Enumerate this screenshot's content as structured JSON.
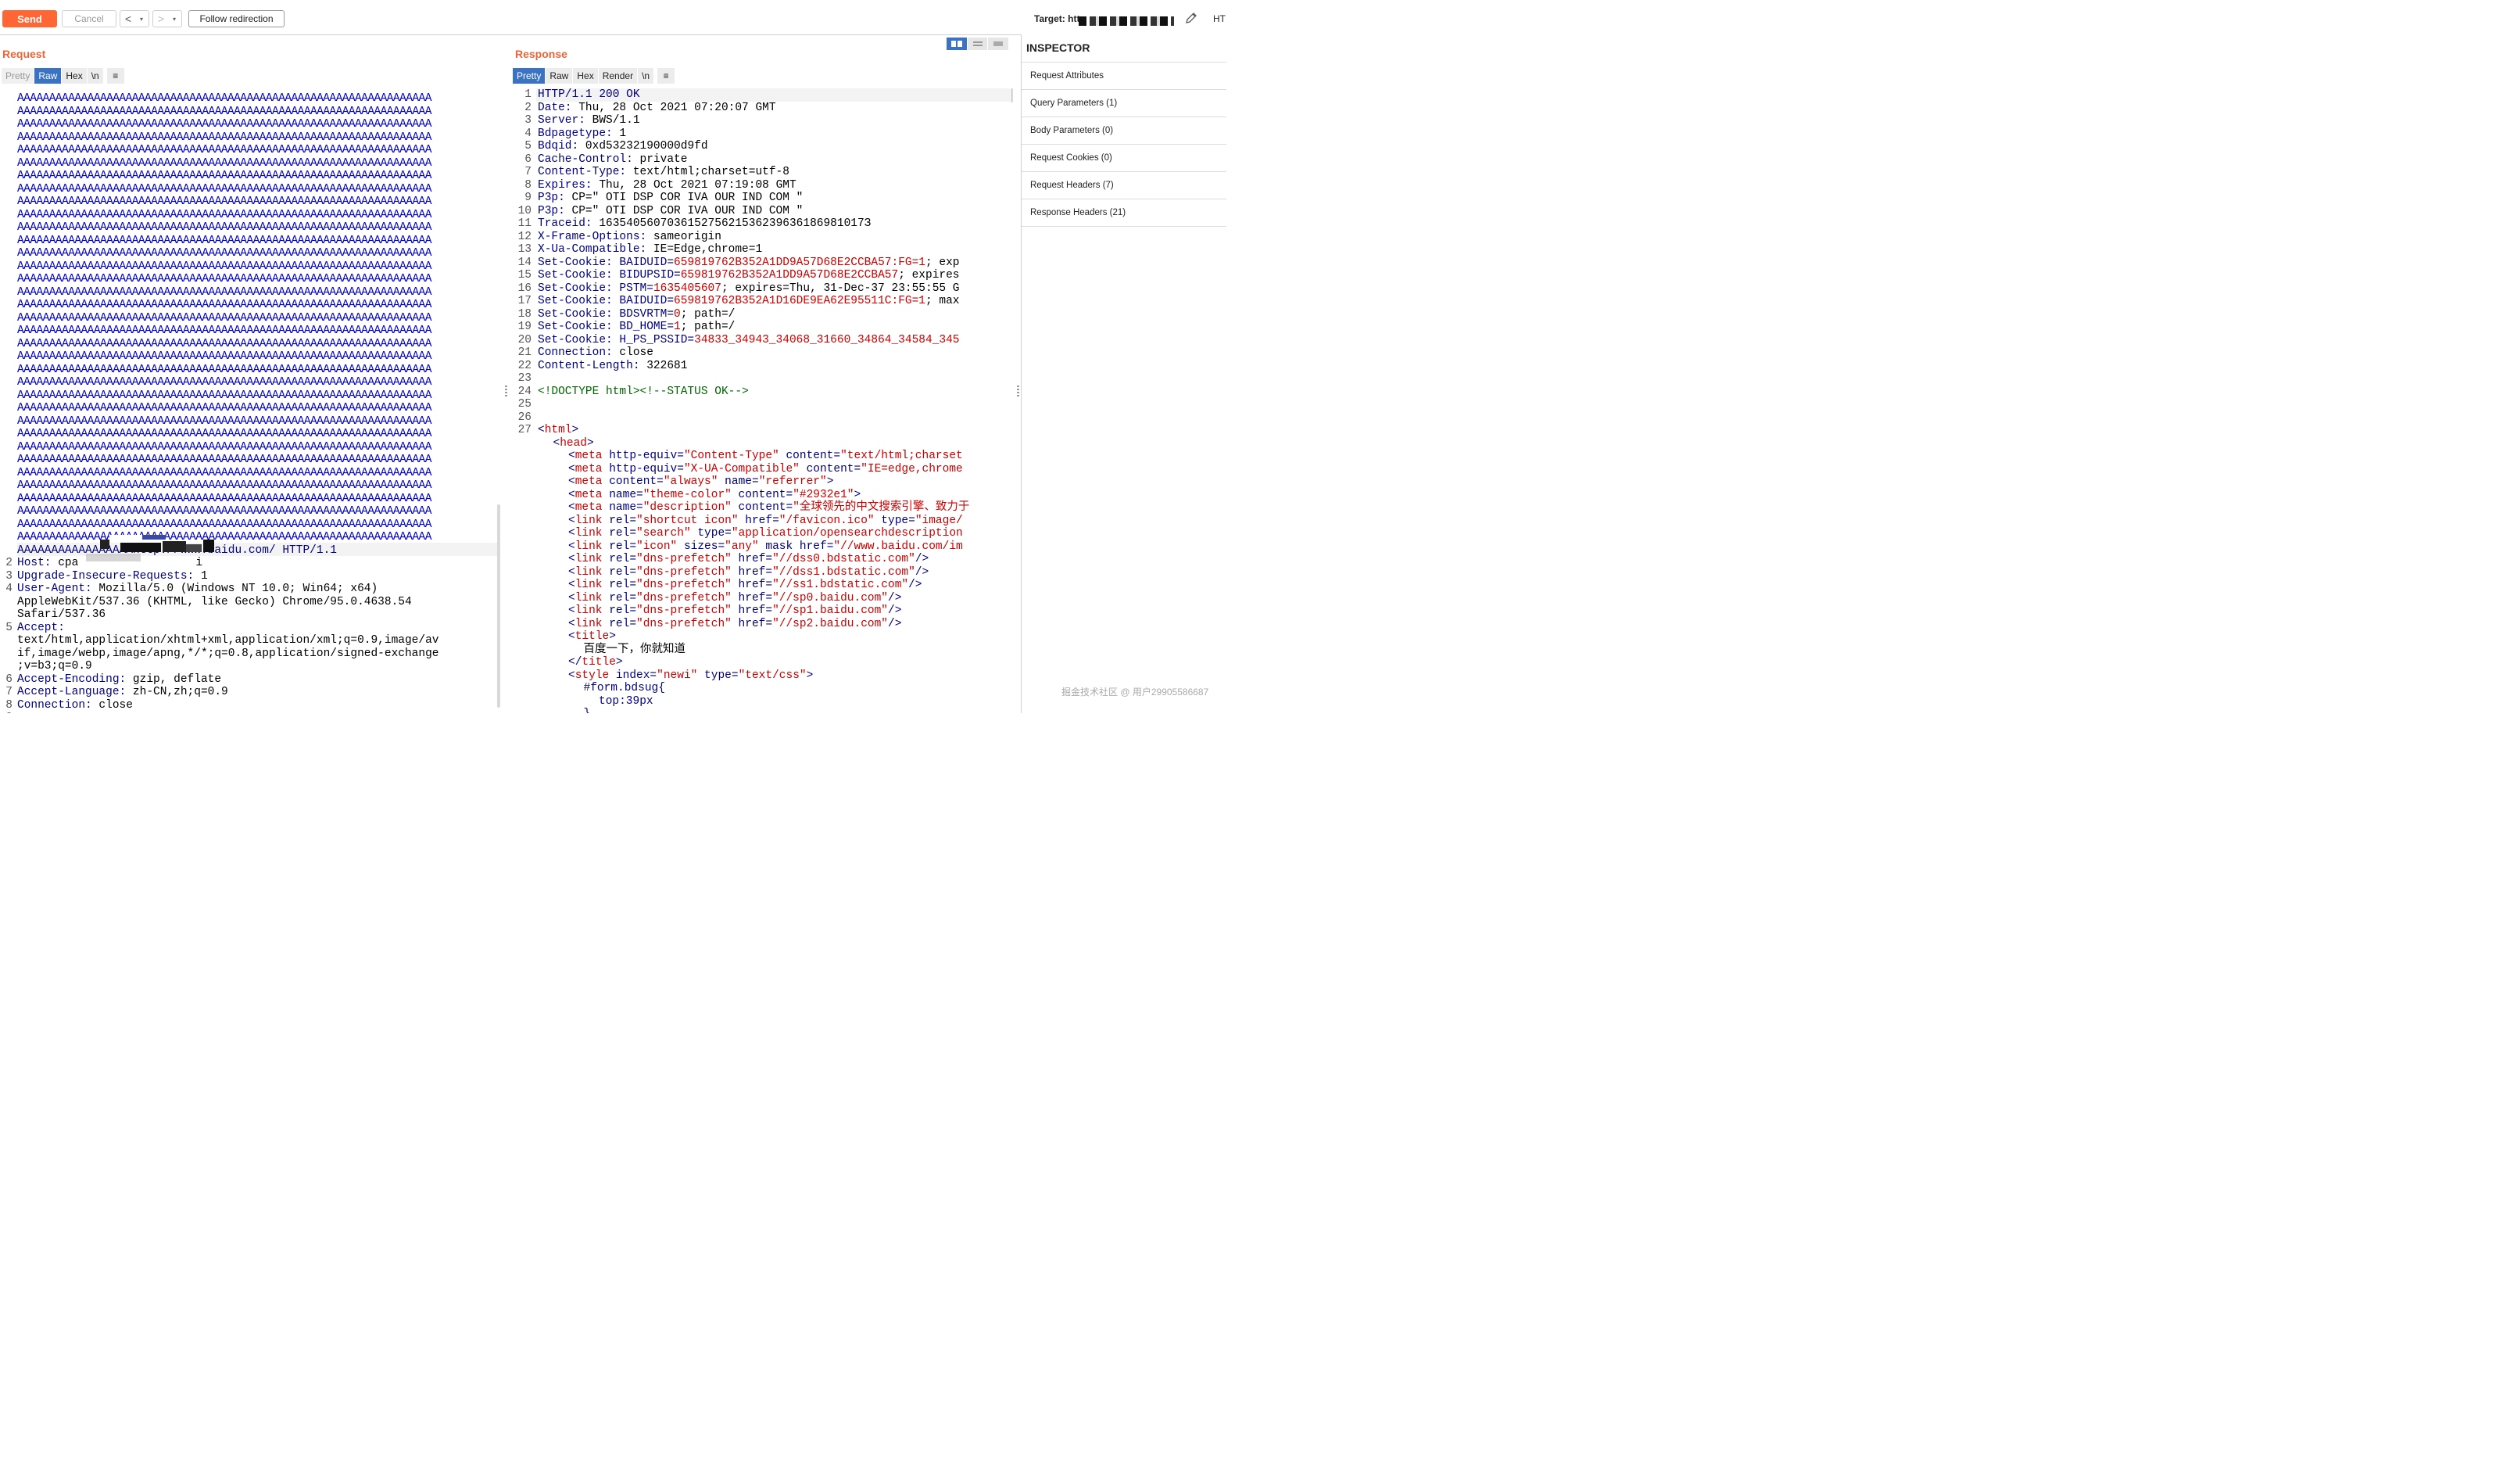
{
  "toolbar": {
    "send_label": "Send",
    "cancel_label": "Cancel",
    "back_glyph": "<",
    "forward_glyph": ">",
    "dropdown_glyph": "▾",
    "follow_label": "Follow redirection",
    "target_label": "Target: htt",
    "right_cut_label": "HT"
  },
  "request": {
    "title": "Request",
    "tabs": [
      "Pretty",
      "Raw",
      "Hex",
      "\\n"
    ],
    "active_tab": "Raw",
    "filler_line": "AAAAAAAAAAAAAAAAAAAAAAAAAAAAAAAAAAAAAAAAAAAAAAAAAAAAAAAAAAAAAAAAA",
    "filler_count": 35,
    "line1_tail": "AAAAAAAAAAAAAAAAAhttp://www.baidu.com/ HTTP/1.1",
    "lines": [
      {
        "n": "2",
        "key": "Host:",
        "val": " cpa",
        "tail": "i"
      },
      {
        "n": "3",
        "key": "Upgrade-Insecure-Requests:",
        "val": " 1"
      },
      {
        "n": "4",
        "key": "User-Agent:",
        "val": " Mozilla/5.0 (Windows NT 10.0; Win64; x64)"
      },
      {
        "n": "",
        "key": "",
        "val": "AppleWebKit/537.36 (KHTML, like Gecko) Chrome/95.0.4638.54"
      },
      {
        "n": "",
        "key": "",
        "val": "Safari/537.36"
      },
      {
        "n": "5",
        "key": "Accept:",
        "val": ""
      },
      {
        "n": "",
        "key": "",
        "val": "text/html,application/xhtml+xml,application/xml;q=0.9,image/av"
      },
      {
        "n": "",
        "key": "",
        "val": "if,image/webp,image/apng,*/*;q=0.8,application/signed-exchange"
      },
      {
        "n": "",
        "key": "",
        "val": ";v=b3;q=0.9"
      },
      {
        "n": "6",
        "key": "Accept-Encoding:",
        "val": " gzip, deflate"
      },
      {
        "n": "7",
        "key": "Accept-Language:",
        "val": " zh-CN,zh;q=0.9"
      },
      {
        "n": "8",
        "key": "Connection:",
        "val": " close"
      },
      {
        "n": "9",
        "key": "",
        "val": ""
      }
    ]
  },
  "response": {
    "title": "Response",
    "tabs": [
      "Pretty",
      "Raw",
      "Hex",
      "Render",
      "\\n"
    ],
    "active_tab": "Pretty",
    "lines": [
      {
        "n": "1",
        "k": "HTTP/1.1 200 OK",
        "v": "",
        "t": ""
      },
      {
        "n": "2",
        "k": "Date:",
        "v": " Thu, 28 Oct 2021 07:20:07 GMT",
        "t": ""
      },
      {
        "n": "3",
        "k": "Server:",
        "v": " BWS/1.1",
        "t": ""
      },
      {
        "n": "4",
        "k": "Bdpagetype:",
        "v": " 1",
        "t": ""
      },
      {
        "n": "5",
        "k": "Bdqid:",
        "v": " 0xd53232190000d9fd",
        "t": ""
      },
      {
        "n": "6",
        "k": "Cache-Control:",
        "v": " private",
        "t": ""
      },
      {
        "n": "7",
        "k": "Content-Type:",
        "v": " text/html;charset=utf-8",
        "t": ""
      },
      {
        "n": "8",
        "k": "Expires:",
        "v": " Thu, 28 Oct 2021 07:19:08 GMT",
        "t": ""
      },
      {
        "n": "9",
        "k": "P3p:",
        "v": " CP=\" OTI DSP COR IVA OUR IND COM \"",
        "t": ""
      },
      {
        "n": "10",
        "k": "P3p:",
        "v": " CP=\" OTI DSP COR IVA OUR IND COM \"",
        "t": ""
      },
      {
        "n": "11",
        "k": "Traceid:",
        "v": " 163540560703615275621536239636186981017З",
        "t": ""
      },
      {
        "n": "12",
        "k": "X-Frame-Options:",
        "v": " sameorigin",
        "t": ""
      },
      {
        "n": "13",
        "k": "X-Ua-Compatible:",
        "v": " IE=Edge,chrome=1",
        "t": ""
      },
      {
        "n": "14",
        "k": "Set-Cookie:",
        "c": " BAIDUID=",
        "r": "659819762B352A1DD9A57D68E2CCBA57:FG=1",
        "t": "; exp"
      },
      {
        "n": "15",
        "k": "Set-Cookie:",
        "c": " BIDUPSID=",
        "r": "659819762B352A1DD9A57D68E2CCBA57",
        "t": "; expires"
      },
      {
        "n": "16",
        "k": "Set-Cookie:",
        "c": " PSTM=",
        "r": "1635405607",
        "t": "; expires=Thu, 31-Dec-37 23:55:55 G"
      },
      {
        "n": "17",
        "k": "Set-Cookie:",
        "c": " BAIDUID=",
        "r": "659819762B352A1D16DE9EA62E95511C:FG=1",
        "t": "; max"
      },
      {
        "n": "18",
        "k": "Set-Cookie:",
        "c": " BDSVRTM=",
        "r": "0",
        "t": "; path=/"
      },
      {
        "n": "19",
        "k": "Set-Cookie:",
        "c": " BD_HOME=",
        "r": "1",
        "t": "; path=/"
      },
      {
        "n": "20",
        "k": "Set-Cookie:",
        "c": " H_PS_PSSID=",
        "r": "34833_34943_34068_31660_34864_34584_345",
        "t": ""
      },
      {
        "n": "21",
        "k": "Connection:",
        "v": " close",
        "t": ""
      },
      {
        "n": "22",
        "k": "Content-Length:",
        "v": " 322681",
        "t": ""
      },
      {
        "n": "23",
        "k": "",
        "v": "",
        "t": ""
      },
      {
        "n": "24",
        "g": "<!DOCTYPE html><!--STATUS OK-->"
      },
      {
        "n": "25",
        "k": "",
        "v": "",
        "t": ""
      },
      {
        "n": "26",
        "k": "",
        "v": "",
        "t": ""
      },
      {
        "n": "27",
        "html": [
          [
            "<",
            "n"
          ],
          [
            "html",
            "r"
          ],
          [
            ">",
            "n"
          ]
        ]
      },
      {
        "n": "",
        "indent": 1,
        "html": [
          [
            "<",
            "n"
          ],
          [
            "head",
            "r"
          ],
          [
            ">",
            "n"
          ]
        ]
      },
      {
        "n": "",
        "indent": 2,
        "html": [
          [
            "<",
            "n"
          ],
          [
            "meta",
            "r"
          ],
          [
            " http-equiv=",
            "n"
          ],
          [
            "\"Content-Type\"",
            "r"
          ],
          [
            " content=",
            "n"
          ],
          [
            "\"text/html;charset",
            "r"
          ]
        ]
      },
      {
        "n": "",
        "indent": 2,
        "html": [
          [
            "<",
            "n"
          ],
          [
            "meta",
            "r"
          ],
          [
            " http-equiv=",
            "n"
          ],
          [
            "\"X-UA-Compatible\"",
            "r"
          ],
          [
            " content=",
            "n"
          ],
          [
            "\"IE=edge,chrome",
            "r"
          ]
        ]
      },
      {
        "n": "",
        "indent": 2,
        "html": [
          [
            "<",
            "n"
          ],
          [
            "meta",
            "r"
          ],
          [
            " content=",
            "n"
          ],
          [
            "\"always\"",
            "r"
          ],
          [
            " name=",
            "n"
          ],
          [
            "\"referrer\"",
            "r"
          ],
          [
            ">",
            "n"
          ]
        ]
      },
      {
        "n": "",
        "indent": 2,
        "html": [
          [
            "<",
            "n"
          ],
          [
            "meta",
            "r"
          ],
          [
            " name=",
            "n"
          ],
          [
            "\"theme-color\"",
            "r"
          ],
          [
            " content=",
            "n"
          ],
          [
            "\"#2932e1\"",
            "r"
          ],
          [
            ">",
            "n"
          ]
        ]
      },
      {
        "n": "",
        "indent": 2,
        "html": [
          [
            "<",
            "n"
          ],
          [
            "meta",
            "r"
          ],
          [
            " name=",
            "n"
          ],
          [
            "\"description\"",
            "r"
          ],
          [
            " content=",
            "n"
          ],
          [
            "\"全球领先的中文搜索引擎、致力于",
            "r"
          ]
        ]
      },
      {
        "n": "",
        "indent": 2,
        "html": [
          [
            "<",
            "n"
          ],
          [
            "link",
            "r"
          ],
          [
            " rel=",
            "n"
          ],
          [
            "\"shortcut icon\"",
            "r"
          ],
          [
            " href=",
            "n"
          ],
          [
            "\"/favicon.ico\"",
            "r"
          ],
          [
            " type=",
            "n"
          ],
          [
            "\"image/",
            "r"
          ]
        ]
      },
      {
        "n": "",
        "indent": 2,
        "html": [
          [
            "<",
            "n"
          ],
          [
            "link",
            "r"
          ],
          [
            " rel=",
            "n"
          ],
          [
            "\"search\"",
            "r"
          ],
          [
            " type=",
            "n"
          ],
          [
            "\"application/opensearchdescription",
            "r"
          ]
        ]
      },
      {
        "n": "",
        "indent": 2,
        "html": [
          [
            "<",
            "n"
          ],
          [
            "link",
            "r"
          ],
          [
            " rel=",
            "n"
          ],
          [
            "\"icon\"",
            "r"
          ],
          [
            " sizes=",
            "n"
          ],
          [
            "\"any\"",
            "r"
          ],
          [
            " mask href=",
            "n"
          ],
          [
            "\"//www.baidu.com/im",
            "r"
          ]
        ]
      },
      {
        "n": "",
        "indent": 2,
        "html": [
          [
            "<",
            "n"
          ],
          [
            "link",
            "r"
          ],
          [
            " rel=",
            "n"
          ],
          [
            "\"dns-prefetch\"",
            "r"
          ],
          [
            " href=",
            "n"
          ],
          [
            "\"//dss0.bdstatic.com\"",
            "r"
          ],
          [
            "/>",
            "n"
          ]
        ]
      },
      {
        "n": "",
        "indent": 2,
        "html": [
          [
            "<",
            "n"
          ],
          [
            "link",
            "r"
          ],
          [
            " rel=",
            "n"
          ],
          [
            "\"dns-prefetch\"",
            "r"
          ],
          [
            " href=",
            "n"
          ],
          [
            "\"//dss1.bdstatic.com\"",
            "r"
          ],
          [
            "/>",
            "n"
          ]
        ]
      },
      {
        "n": "",
        "indent": 2,
        "html": [
          [
            "<",
            "n"
          ],
          [
            "link",
            "r"
          ],
          [
            " rel=",
            "n"
          ],
          [
            "\"dns-prefetch\"",
            "r"
          ],
          [
            " href=",
            "n"
          ],
          [
            "\"//ss1.bdstatic.com\"",
            "r"
          ],
          [
            "/>",
            "n"
          ]
        ]
      },
      {
        "n": "",
        "indent": 2,
        "html": [
          [
            "<",
            "n"
          ],
          [
            "link",
            "r"
          ],
          [
            " rel=",
            "n"
          ],
          [
            "\"dns-prefetch\"",
            "r"
          ],
          [
            " href=",
            "n"
          ],
          [
            "\"//sp0.baidu.com\"",
            "r"
          ],
          [
            "/>",
            "n"
          ]
        ]
      },
      {
        "n": "",
        "indent": 2,
        "html": [
          [
            "<",
            "n"
          ],
          [
            "link",
            "r"
          ],
          [
            " rel=",
            "n"
          ],
          [
            "\"dns-prefetch\"",
            "r"
          ],
          [
            " href=",
            "n"
          ],
          [
            "\"//sp1.baidu.com\"",
            "r"
          ],
          [
            "/>",
            "n"
          ]
        ]
      },
      {
        "n": "",
        "indent": 2,
        "html": [
          [
            "<",
            "n"
          ],
          [
            "link",
            "r"
          ],
          [
            " rel=",
            "n"
          ],
          [
            "\"dns-prefetch\"",
            "r"
          ],
          [
            " href=",
            "n"
          ],
          [
            "\"//sp2.baidu.com\"",
            "r"
          ],
          [
            "/>",
            "n"
          ]
        ]
      },
      {
        "n": "",
        "indent": 2,
        "html": [
          [
            "<",
            "n"
          ],
          [
            "title",
            "r"
          ],
          [
            ">",
            "n"
          ]
        ]
      },
      {
        "n": "",
        "indent": 3,
        "html": [
          [
            "百度一下，你就知道",
            "b"
          ]
        ]
      },
      {
        "n": "",
        "indent": 2,
        "html": [
          [
            "</",
            "n"
          ],
          [
            "title",
            "r"
          ],
          [
            ">",
            "n"
          ]
        ]
      },
      {
        "n": "",
        "indent": 2,
        "html": [
          [
            "<",
            "n"
          ],
          [
            "style",
            "r"
          ],
          [
            " index=",
            "n"
          ],
          [
            "\"newi\"",
            "r"
          ],
          [
            " type=",
            "n"
          ],
          [
            "\"text/css\"",
            "r"
          ],
          [
            ">",
            "n"
          ]
        ]
      },
      {
        "n": "",
        "indent": 3,
        "html": [
          [
            "#form.bdsug{",
            "n"
          ]
        ]
      },
      {
        "n": "",
        "indent": 4,
        "html": [
          [
            "top:39px",
            "n"
          ]
        ]
      },
      {
        "n": "",
        "indent": 3,
        "html": [
          [
            "}",
            "n"
          ]
        ]
      }
    ]
  },
  "inspector": {
    "title": "INSPECTOR",
    "items": [
      "Request Attributes",
      "Query Parameters (1)",
      "Body Parameters (0)",
      "Request Cookies (0)",
      "Request Headers (7)",
      "Response Headers (21)"
    ]
  },
  "watermark": "掘金技术社区 @ 用户2990558668​7",
  "colors": {
    "accent": "#ff6633",
    "tab_active": "#3a73c4",
    "title": "#e8663a"
  }
}
